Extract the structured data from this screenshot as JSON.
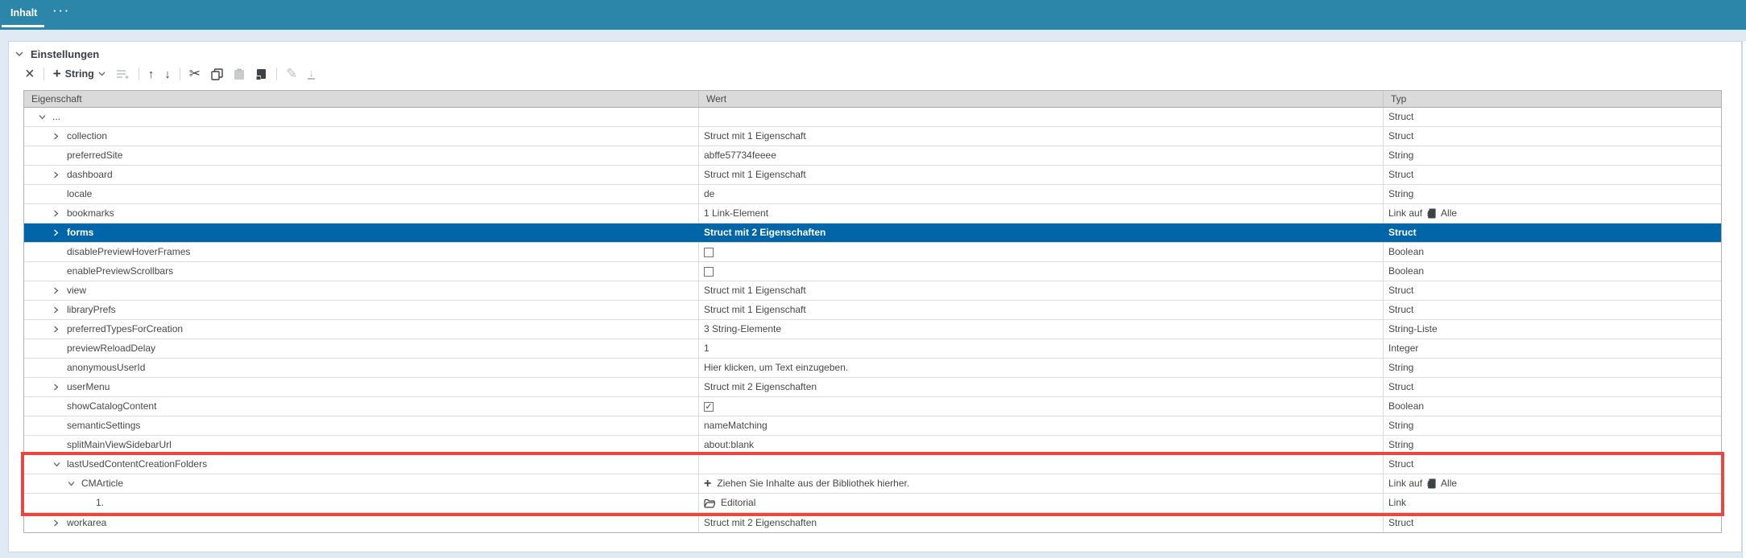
{
  "colors": {
    "tabbar": "#2b86a9",
    "selection": "#0066a7",
    "highlight_border": "#e74940",
    "header_bg": "#dadada",
    "panel_bg": "#ffffff",
    "page_bg": "#dfeaf4"
  },
  "tabs": {
    "active_label": "Inhalt",
    "more_label": "···"
  },
  "section": {
    "title": "Einstellungen",
    "collapse_icon": "chevron-down-icon"
  },
  "toolbar": {
    "add_type_label": "String",
    "buttons": [
      {
        "name": "remove-property-button",
        "icon": "x-delete-icon",
        "enabled": true
      },
      {
        "name": "add-property-button",
        "icon": "plus-icon",
        "label": "String",
        "dropdown": true,
        "enabled": true
      },
      {
        "name": "add-list-item-button",
        "icon": "list-add-icon",
        "enabled": false
      },
      {
        "name": "move-up-button",
        "icon": "arrow-up-icon",
        "enabled": true
      },
      {
        "name": "move-down-button",
        "icon": "arrow-down-icon",
        "enabled": true
      },
      {
        "name": "cut-button",
        "icon": "scissors-icon",
        "enabled": true
      },
      {
        "name": "copy-button",
        "icon": "copy-icon",
        "enabled": true
      },
      {
        "name": "paste-button",
        "icon": "paste-icon",
        "enabled": false
      },
      {
        "name": "paste-into-button",
        "icon": "paste-into-icon",
        "enabled": true
      },
      {
        "name": "edit-button",
        "icon": "pencil-icon",
        "enabled": false
      },
      {
        "name": "apply-default-button",
        "icon": "download-icon",
        "enabled": false
      }
    ]
  },
  "table": {
    "columns": [
      "Eigenschaft",
      "Wert",
      "Typ"
    ],
    "rows": [
      {
        "name": "...",
        "depth": 1,
        "chevron": "down",
        "value": {
          "kind": "text",
          "text": ""
        },
        "type": {
          "label": "Struct"
        }
      },
      {
        "name": "collection",
        "depth": 2,
        "chevron": "right",
        "value": {
          "kind": "text",
          "text": "Struct mit 1 Eigenschaft"
        },
        "type": {
          "label": "Struct"
        }
      },
      {
        "name": "preferredSite",
        "depth": 2,
        "chevron": null,
        "value": {
          "kind": "text",
          "text": "abffe57734feeee"
        },
        "type": {
          "label": "String"
        }
      },
      {
        "name": "dashboard",
        "depth": 2,
        "chevron": "right",
        "value": {
          "kind": "text",
          "text": "Struct mit 1 Eigenschaft"
        },
        "type": {
          "label": "Struct"
        }
      },
      {
        "name": "locale",
        "depth": 2,
        "chevron": null,
        "value": {
          "kind": "text",
          "text": "de"
        },
        "type": {
          "label": "String"
        }
      },
      {
        "name": "bookmarks",
        "depth": 2,
        "chevron": "right",
        "value": {
          "kind": "text",
          "text": "1 Link-Element"
        },
        "type": {
          "label": "Link auf",
          "icon": "content-type-all-icon",
          "suffix": "Alle"
        }
      },
      {
        "name": "forms",
        "depth": 2,
        "chevron": "right",
        "selected": true,
        "value": {
          "kind": "text",
          "text": "Struct mit 2 Eigenschaften"
        },
        "type": {
          "label": "Struct"
        }
      },
      {
        "name": "disablePreviewHoverFrames",
        "depth": 2,
        "chevron": null,
        "value": {
          "kind": "checkbox",
          "checked": false
        },
        "type": {
          "label": "Boolean"
        }
      },
      {
        "name": "enablePreviewScrollbars",
        "depth": 2,
        "chevron": null,
        "value": {
          "kind": "checkbox",
          "checked": false
        },
        "type": {
          "label": "Boolean"
        }
      },
      {
        "name": "view",
        "depth": 2,
        "chevron": "right",
        "value": {
          "kind": "text",
          "text": "Struct mit 1 Eigenschaft"
        },
        "type": {
          "label": "Struct"
        }
      },
      {
        "name": "libraryPrefs",
        "depth": 2,
        "chevron": "right",
        "value": {
          "kind": "text",
          "text": "Struct mit 1 Eigenschaft"
        },
        "type": {
          "label": "Struct"
        }
      },
      {
        "name": "preferredTypesForCreation",
        "depth": 2,
        "chevron": "right",
        "value": {
          "kind": "text",
          "text": "3 String-Elemente"
        },
        "type": {
          "label": "String-Liste"
        }
      },
      {
        "name": "previewReloadDelay",
        "depth": 2,
        "chevron": null,
        "value": {
          "kind": "text",
          "text": "1"
        },
        "type": {
          "label": "Integer"
        }
      },
      {
        "name": "anonymousUserId",
        "depth": 2,
        "chevron": null,
        "value": {
          "kind": "text",
          "text": "Hier klicken, um Text einzugeben."
        },
        "type": {
          "label": "String"
        }
      },
      {
        "name": "userMenu",
        "depth": 2,
        "chevron": "right",
        "value": {
          "kind": "text",
          "text": "Struct mit 2 Eigenschaften"
        },
        "type": {
          "label": "Struct"
        }
      },
      {
        "name": "showCatalogContent",
        "depth": 2,
        "chevron": null,
        "value": {
          "kind": "checkbox",
          "checked": true
        },
        "type": {
          "label": "Boolean"
        }
      },
      {
        "name": "semanticSettings",
        "depth": 2,
        "chevron": null,
        "value": {
          "kind": "text",
          "text": "nameMatching"
        },
        "type": {
          "label": "String"
        }
      },
      {
        "name": "splitMainViewSidebarUrl",
        "depth": 2,
        "chevron": null,
        "value": {
          "kind": "text",
          "text": "about:blank"
        },
        "type": {
          "label": "String"
        }
      },
      {
        "name": "lastUsedContentCreationFolders",
        "depth": 2,
        "chevron": "down",
        "highlighted": true,
        "value": {
          "kind": "text",
          "text": ""
        },
        "type": {
          "label": "Struct"
        }
      },
      {
        "name": "CMArticle",
        "depth": 3,
        "chevron": "down",
        "highlighted": true,
        "value": {
          "kind": "dropzone",
          "icon": "plus-icon",
          "text": "Ziehen Sie Inhalte aus der Bibliothek hierher."
        },
        "type": {
          "label": "Link auf",
          "icon": "content-type-all-icon",
          "suffix": "Alle"
        }
      },
      {
        "name": "1.",
        "depth": 4,
        "chevron": null,
        "highlighted": true,
        "value": {
          "kind": "folder",
          "icon": "folder-icon",
          "text": "Editorial"
        },
        "type": {
          "label": "Link"
        }
      },
      {
        "name": "workarea",
        "depth": 2,
        "chevron": "right",
        "value": {
          "kind": "text",
          "text": "Struct mit 2 Eigenschaften"
        },
        "type": {
          "label": "Struct"
        }
      }
    ]
  }
}
